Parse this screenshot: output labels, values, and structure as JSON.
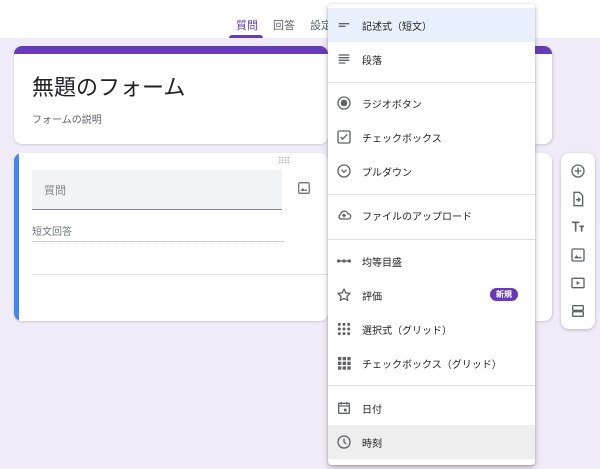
{
  "tabs": [
    {
      "label": "質問",
      "active": true
    },
    {
      "label": "回答",
      "active": false
    },
    {
      "label": "設定",
      "active": false
    }
  ],
  "form": {
    "title": "無題のフォーム",
    "description": "フォームの説明"
  },
  "question": {
    "placeholder": "質問",
    "answer_type_label": "短文回答"
  },
  "menu": {
    "items": [
      {
        "label": "記述式（短文）",
        "icon": "short-answer-icon"
      },
      {
        "label": "段落",
        "icon": "paragraph-icon"
      },
      {
        "label": "ラジオボタン",
        "icon": "radio-button-icon"
      },
      {
        "label": "チェックボックス",
        "icon": "checkbox-icon"
      },
      {
        "label": "プルダウン",
        "icon": "dropdown-icon"
      },
      {
        "label": "ファイルのアップロード",
        "icon": "cloud-upload-icon"
      },
      {
        "label": "均等目盛",
        "icon": "linear-scale-icon"
      },
      {
        "label": "評価",
        "icon": "star-icon",
        "badge": "新規"
      },
      {
        "label": "選択式（グリッド）",
        "icon": "grid-icon"
      },
      {
        "label": "チェックボックス（グリッド）",
        "icon": "checkbox-grid-icon"
      },
      {
        "label": "日付",
        "icon": "calendar-icon"
      },
      {
        "label": "時刻",
        "icon": "clock-icon"
      }
    ]
  },
  "toolbar": {
    "icons": [
      "add-question-icon",
      "import-questions-icon",
      "add-title-icon",
      "add-image-icon",
      "add-video-icon",
      "add-section-icon"
    ]
  },
  "colors": {
    "accent": "#673ab7",
    "background": "#f0ebf8",
    "question_bar": "#4285f4"
  }
}
